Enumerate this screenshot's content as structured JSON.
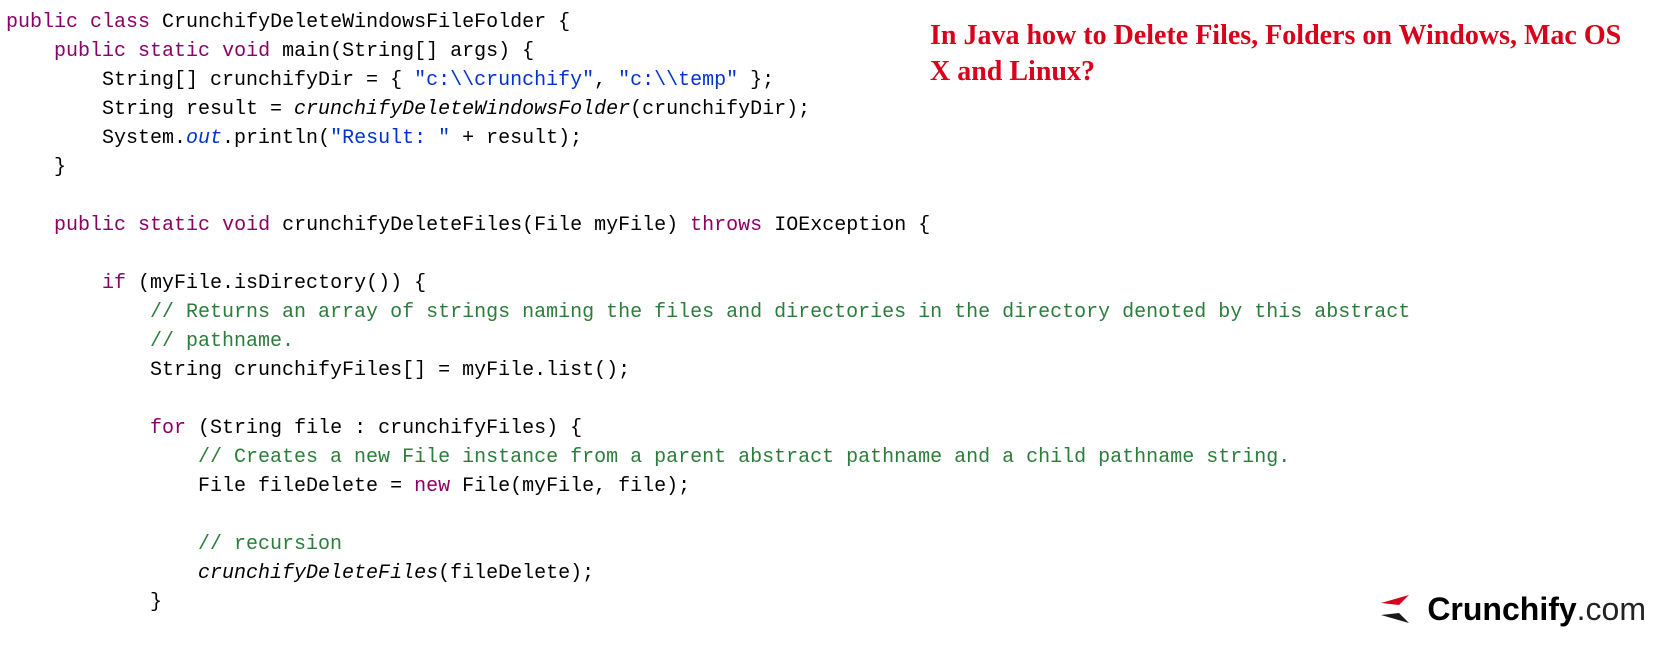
{
  "title": "In Java how to Delete Files, Folders on Windows, Mac OS X and Linux?",
  "brand": {
    "name": "Crunchify",
    "domain": ".com"
  },
  "code": {
    "kw_public": "public",
    "kw_class": "class",
    "kw_static": "static",
    "kw_void": "void",
    "kw_throws": "throws",
    "kw_if": "if",
    "kw_for": "for",
    "kw_new": "new",
    "className": " CrunchifyDeleteWindowsFileFolder {",
    "mainSig": " main(String[] args) {",
    "l3a": "        String[] crunchifyDir = { ",
    "s1": "\"c:\\\\crunchify\"",
    "comma": ", ",
    "s2": "\"c:\\\\temp\"",
    "l3b": " };",
    "l4a": "        String result = ",
    "l4b": "crunchifyDeleteWindowsFolder",
    "l4c": "(crunchifyDir);",
    "l5a": "        System.",
    "l5out": "out",
    "l5b": ".println(",
    "s3": "\"Result: \"",
    "l5c": " + result);",
    "l6": "    }",
    "m2sig": " crunchifyDeleteFiles(File myFile) ",
    "m2sig2": " IOException {",
    "l9a": " (myFile.isDirectory()) {",
    "c1a": "            // Returns an array of strings naming the files and directories in the directory denoted by this abstract",
    "c1b": "            // pathname.",
    "l12": "            String crunchifyFiles[] = myFile.list();",
    "l14a": " (String file : crunchifyFiles) {",
    "c2": "                // Creates a new File instance from a parent abstract pathname and a child pathname string.",
    "l16a": "                File fileDelete = ",
    "l16b": " File(myFile, file);",
    "c3": "                // recursion",
    "l19a": "                ",
    "l19b": "crunchifyDeleteFiles",
    "l19c": "(fileDelete);",
    "l20": "            }",
    "sp": " ",
    "ind4": "    ",
    "ind8": "        ",
    "ind12": "            "
  }
}
